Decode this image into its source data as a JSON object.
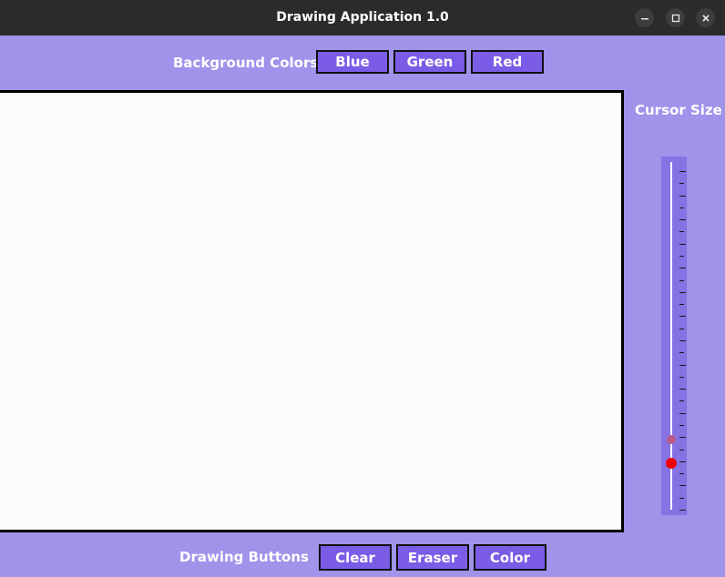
{
  "window": {
    "title": "Drawing Application 1.0",
    "controls": {
      "minimize_icon": "minimize-icon",
      "maximize_icon": "maximize-icon",
      "close_icon": "close-icon"
    }
  },
  "background_colors": {
    "label": "Background Colors",
    "buttons": [
      "Blue",
      "Green",
      "Red"
    ]
  },
  "cursor_size": {
    "label": "Cursor Size",
    "value_fraction": 0.13
  },
  "drawing_buttons": {
    "label": "Drawing Buttons",
    "buttons": [
      "Clear",
      "Eraser",
      "Color"
    ]
  },
  "colors": {
    "window_bg": "#9f93ea",
    "button_bg": "#7b5ce6",
    "canvas_bg": "#fbfbf9",
    "slider_knob": "#ee0000"
  }
}
